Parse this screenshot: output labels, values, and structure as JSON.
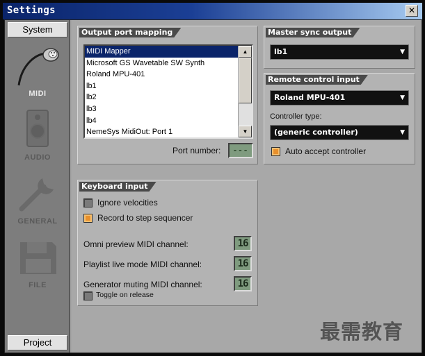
{
  "window": {
    "title": "Settings",
    "close_glyph": "✕"
  },
  "sidebar": {
    "system_button": "System",
    "project_button": "Project",
    "items": [
      {
        "label": "MIDI",
        "icon": "midi-plug-icon",
        "active": true
      },
      {
        "label": "AUDIO",
        "icon": "speaker-icon",
        "active": false
      },
      {
        "label": "GENERAL",
        "icon": "wrench-icon",
        "active": false
      },
      {
        "label": "FILE",
        "icon": "floppy-disk-icon",
        "active": false
      }
    ]
  },
  "output_port": {
    "title": "Output port mapping",
    "ports": [
      "MIDI Mapper",
      "Microsoft GS Wavetable SW Synth",
      "Roland MPU-401",
      "lb1",
      "lb2",
      "lb3",
      "lb4",
      "NemeSys MidiOut: Port 1"
    ],
    "selected": "MIDI Mapper",
    "port_number_label": "Port number:",
    "port_number_value": "---"
  },
  "master_sync": {
    "title": "Master sync output",
    "value": "lb1"
  },
  "remote_control": {
    "title": "Remote control input",
    "input_value": "Roland MPU-401",
    "controller_type_label": "Controller type:",
    "controller_type_value": "(generic controller)",
    "auto_accept_label": "Auto accept controller",
    "auto_accept_checked": true
  },
  "keyboard": {
    "title": "Keyboard input",
    "ignore_velocities_label": "Ignore velocities",
    "ignore_velocities_checked": false,
    "record_step_label": "Record to step sequencer",
    "record_step_checked": true,
    "omni_label": "Omni preview MIDI channel:",
    "omni_value": "16",
    "playlist_label": "Playlist live mode MIDI channel:",
    "playlist_value": "16",
    "generator_label": "Generator muting MIDI channel:",
    "generator_value": "16",
    "toggle_release_label": "Toggle on release",
    "toggle_release_checked": false
  },
  "scroll_glyphs": {
    "up": "▲",
    "down": "▼",
    "dropdown": "▼"
  },
  "watermark": "最需教育",
  "colors": {
    "titlebar": "#0a246a",
    "selection": "#0a246a",
    "checkbox_on": "#e8902c",
    "lcd": "#7f9b7f"
  }
}
